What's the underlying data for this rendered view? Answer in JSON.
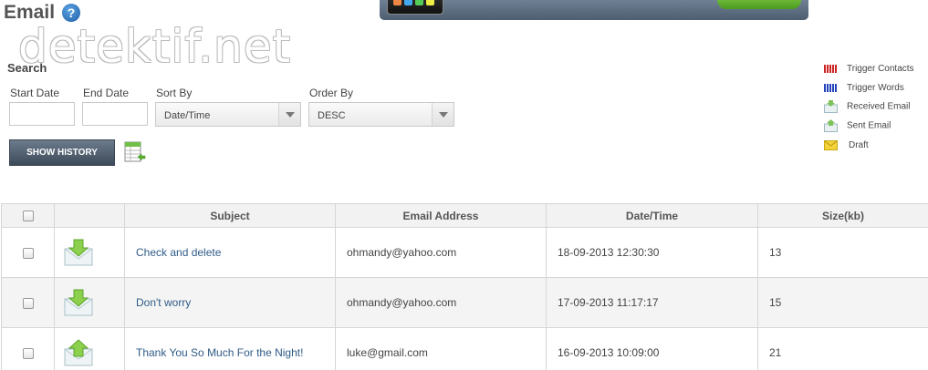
{
  "page_title": "Email",
  "watermark": "detektif.net",
  "search": {
    "label": "Search",
    "start_date_label": "Start Date",
    "end_date_label": "End Date",
    "start_date_value": "",
    "end_date_value": "",
    "sort_by_label": "Sort By",
    "sort_by_value": "Date/Time",
    "order_by_label": "Order By",
    "order_by_value": "DESC",
    "show_history_label": "SHOW HISTORY"
  },
  "legend": [
    {
      "label": "Trigger Contacts",
      "icon": "red-bars-icon",
      "color": "#cc2222"
    },
    {
      "label": "Trigger Words",
      "icon": "blue-bars-icon",
      "color": "#2244bb"
    },
    {
      "label": "Received Email",
      "icon": "received-email-icon",
      "color": "#7cc35a"
    },
    {
      "label": "Sent Email",
      "icon": "sent-email-icon",
      "color": "#7cc35a"
    },
    {
      "label": "Draft",
      "icon": "draft-email-icon",
      "color": "#e8c21a"
    }
  ],
  "table": {
    "headers": [
      "Subject",
      "Email Address",
      "Date/Time",
      "Size(kb)"
    ],
    "rows": [
      {
        "type": "received",
        "subject": "Check and delete",
        "email": "ohmandy@yahoo.com",
        "datetime": "18-09-2013 12:30:30",
        "size": "13"
      },
      {
        "type": "received",
        "subject": "Don't worry",
        "email": "ohmandy@yahoo.com",
        "datetime": "17-09-2013 11:17:17",
        "size": "15"
      },
      {
        "type": "sent",
        "subject": "Thank You So Much For the Night!",
        "email": "luke@gmail.com",
        "datetime": "16-09-2013 10:09:00",
        "size": "21"
      }
    ]
  },
  "colors": {
    "link": "#2f5b87",
    "button": "#4a5868",
    "header_bg": "#f2f2f2"
  }
}
